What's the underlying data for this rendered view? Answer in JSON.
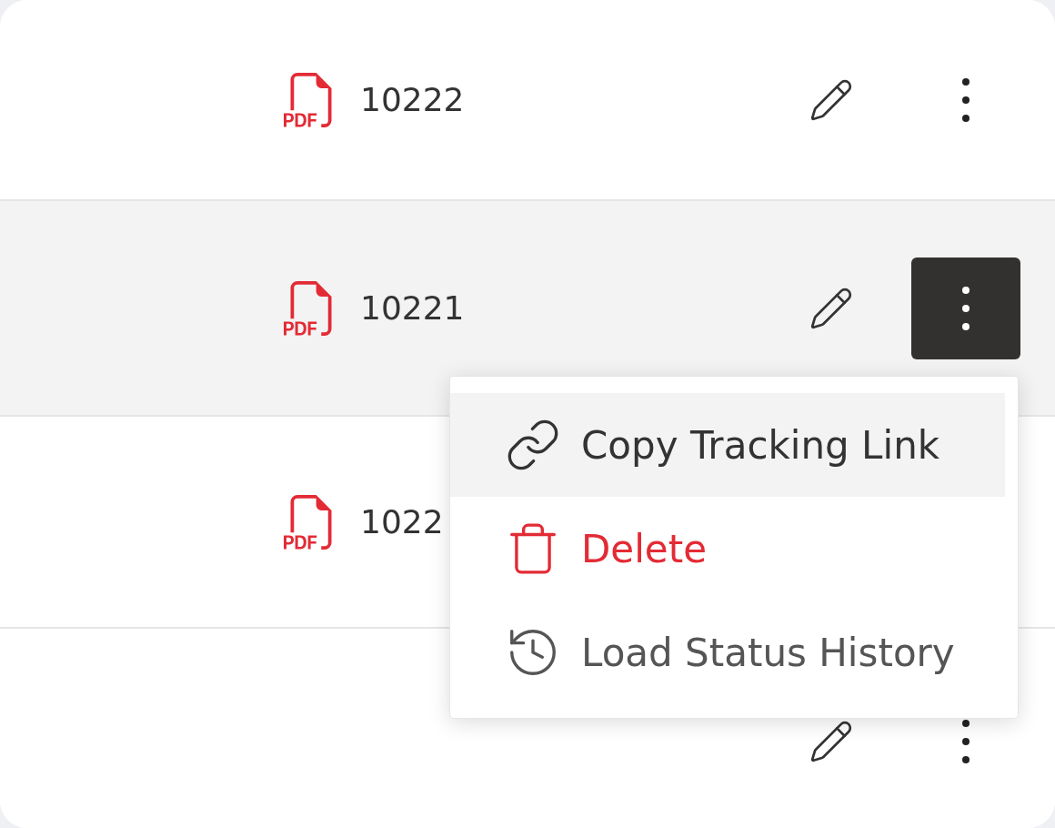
{
  "rows": [
    {
      "document": "10222",
      "highlighted": false,
      "menu_open": false
    },
    {
      "document": "10221",
      "highlighted": true,
      "menu_open": true
    },
    {
      "document": "1022",
      "highlighted": false
    },
    {
      "highlighted": false,
      "menu_open": false
    }
  ],
  "menu": {
    "items": [
      {
        "kind": "link",
        "label": "Copy Tracking Link",
        "highlighted": true
      },
      {
        "kind": "delete",
        "label": "Delete",
        "highlighted": false
      },
      {
        "kind": "history",
        "label": "Load Status History",
        "highlighted": false
      }
    ]
  }
}
